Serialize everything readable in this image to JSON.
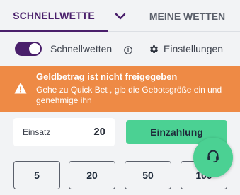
{
  "tabs": {
    "active_label": "SCHNELLWETTE",
    "other_label": "MEINE WETTEN"
  },
  "toggle": {
    "label": "Schnellwetten",
    "on": true
  },
  "settings": {
    "label": "Einstellungen"
  },
  "alert": {
    "title": "Geldbetrag ist nicht freigegeben",
    "text": "Gehe zu Quick Bet , gib die Gebotsgröße ein und genehmige ihn"
  },
  "stake": {
    "label": "Einsatz",
    "value": "20"
  },
  "deposit": {
    "label": "Einzahlung"
  },
  "quick_amounts": [
    "5",
    "20",
    "50",
    "100"
  ],
  "colors": {
    "brand": "#4a1f6b",
    "alert": "#ee8a45",
    "accent": "#4bd193"
  },
  "icons": {
    "tab_chevron": "chevron-down-icon",
    "info": "info-icon",
    "settings": "gear-icon",
    "alert": "warning-icon",
    "support": "headset-icon"
  }
}
